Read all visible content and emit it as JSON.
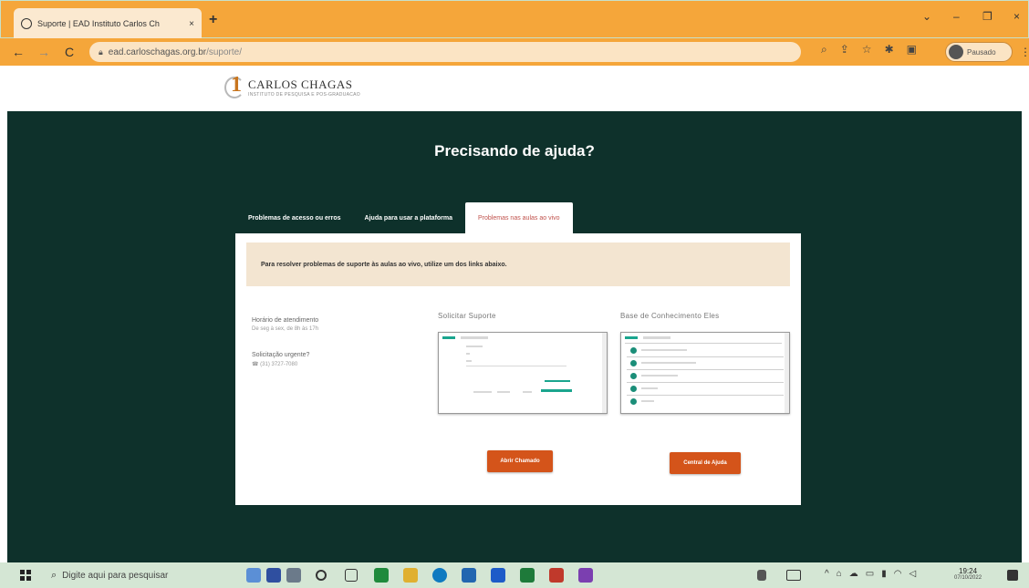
{
  "browser": {
    "tab_title": "Suporte | EAD Instituto Carlos Ch",
    "tab_close": "×",
    "new_tab": "+",
    "url_domain": "ead.carloschagas.org.br",
    "url_path": "/suporte/",
    "profile_label": "Pausado",
    "window_controls": [
      "⌄",
      "–",
      "❐",
      "×"
    ]
  },
  "site": {
    "logo_name": "CARLOS CHAGAS",
    "logo_sub": "INSTITUTO DE PESQUISA E POS-GRADUACAO",
    "logo_numeral": "1"
  },
  "main": {
    "title": "Precisando de ajuda?",
    "tabs": [
      {
        "label": "Problemas de acesso ou erros",
        "active": false
      },
      {
        "label": "Ajuda para usar a plataforma",
        "active": false
      },
      {
        "label": "Problemas nas aulas ao vivo",
        "active": true
      }
    ],
    "notice": "Para resolver problemas de suporte às aulas ao vivo, utilize um dos links abaixo.",
    "hours_label": "Horário de atendimento",
    "hours_value": "De seg à sex, de 8h às 17h",
    "urgent_label": "Solicitação urgente?",
    "urgent_value": "☎ (31) 3727-7080",
    "col1_title": "Solicitar Suporte",
    "col2_title": "Base de Conhecimento Eles",
    "btn1_label": "Abrir Chamado",
    "btn2_label": "Central de Ajuda"
  },
  "taskbar": {
    "search_placeholder": "Digite aqui para pesquisar",
    "time": "19:24",
    "date": "07/10/2022"
  },
  "colors": {
    "browser_chrome": "#f5a63a",
    "main_bg": "#0e312b",
    "button": "#d4541a",
    "active_tab_text": "#c0524c",
    "notice_bg": "#f3e5d1"
  }
}
